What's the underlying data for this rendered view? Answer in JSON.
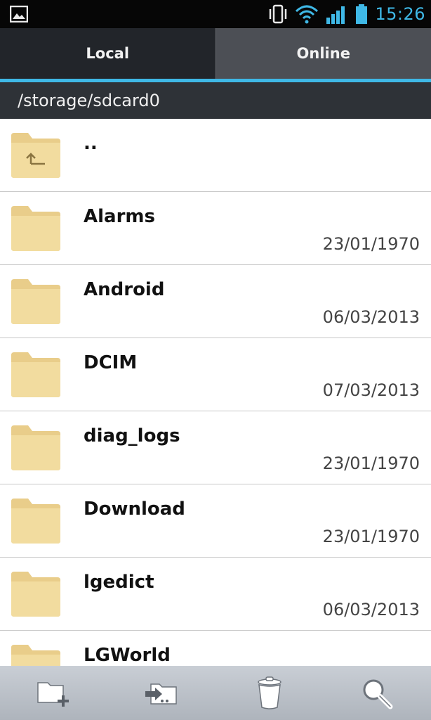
{
  "status_bar": {
    "time": "15:26",
    "icons": [
      "gallery-notification-icon",
      "vibrate-icon",
      "wifi-icon",
      "signal-icon",
      "battery-icon"
    ]
  },
  "tabs": [
    {
      "label": "Local",
      "active": true
    },
    {
      "label": "Online",
      "active": false
    }
  ],
  "path": "/storage/sdcard0",
  "files": [
    {
      "name": "..",
      "date": "",
      "type": "parent-folder"
    },
    {
      "name": "Alarms",
      "date": "23/01/1970",
      "type": "folder"
    },
    {
      "name": "Android",
      "date": "06/03/2013",
      "type": "folder"
    },
    {
      "name": "DCIM",
      "date": "07/03/2013",
      "type": "folder"
    },
    {
      "name": "diag_logs",
      "date": "23/01/1970",
      "type": "folder"
    },
    {
      "name": "Download",
      "date": "23/01/1970",
      "type": "folder"
    },
    {
      "name": "lgedict",
      "date": "06/03/2013",
      "type": "folder"
    },
    {
      "name": "LGWorld",
      "date": "",
      "type": "folder"
    }
  ],
  "toolbar": {
    "buttons": [
      "new-folder-icon",
      "move-icon",
      "trash-icon",
      "search-icon"
    ]
  },
  "colors": {
    "accent": "#3fb8e6",
    "folder": "#f0d79a"
  }
}
